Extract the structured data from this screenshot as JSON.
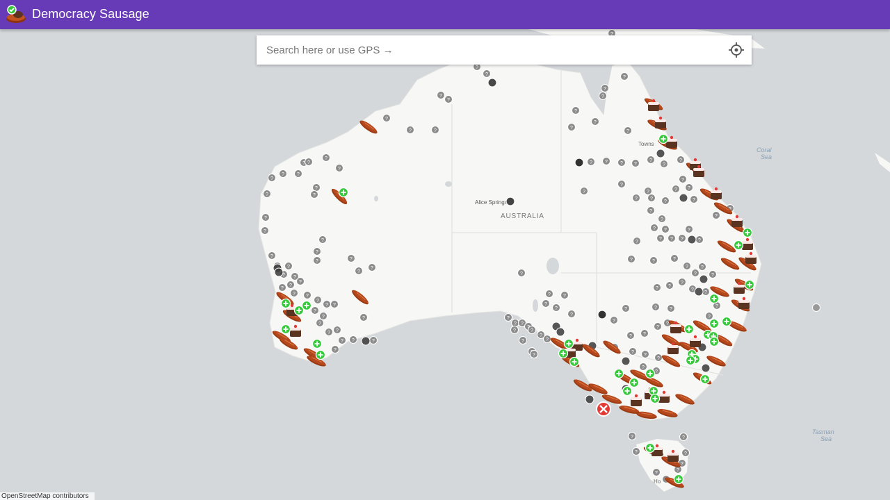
{
  "app": {
    "title": "Democracy Sausage"
  },
  "search": {
    "placeholder": "Search here or use GPS →"
  },
  "map": {
    "place_labels": {
      "alice_springs": "Alice Springs",
      "australia": "AUSTRALIA",
      "townsville": "Towns",
      "hobart": "Ho"
    },
    "sea_labels": {
      "coral_line1": "Coral",
      "coral_line2": "Sea",
      "tasman_line1": "Tasman",
      "tasman_line2": "Sea"
    },
    "attribution": "OpenStreetMap contributors"
  },
  "marker_legend": {
    "unknown": "?",
    "sausage": "sausage-sizzle",
    "cake": "cake-stall",
    "extra": "plus",
    "red_cross": "x"
  },
  "colors": {
    "header": "#673ab7",
    "land": "#f7f7f5",
    "water": "#d4d8db",
    "unknown_marker": "#8c8c8c",
    "sausage": "#b5481d",
    "plus_badge": "#35c93b",
    "red_marker": "#e53935"
  }
}
